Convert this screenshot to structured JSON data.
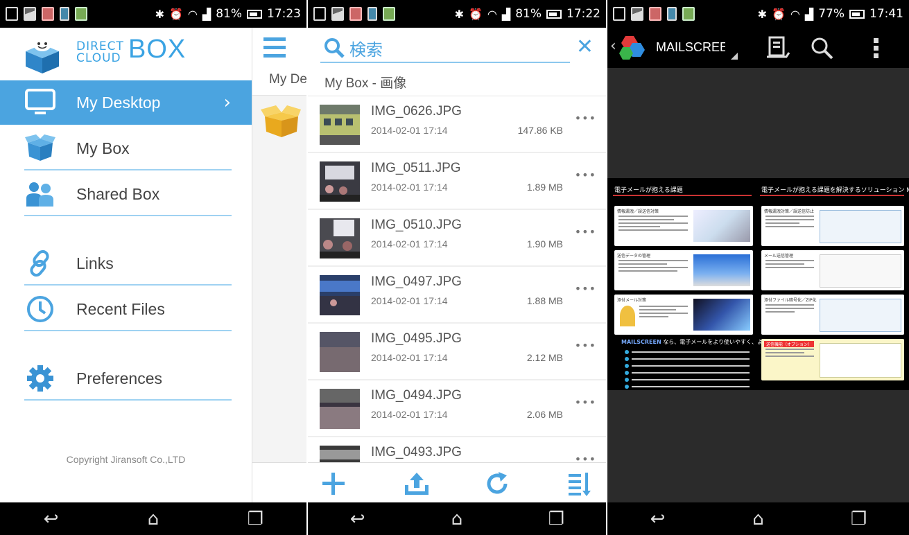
{
  "panel1": {
    "status": {
      "battery": "81%",
      "time": "17:23"
    },
    "logo": {
      "small_line1": "DIRECT",
      "small_line2": "CLOUD",
      "big": "BOX"
    },
    "menu": [
      {
        "label": "My Desktop",
        "icon": "monitor-icon",
        "active": true
      },
      {
        "label": "My Box",
        "icon": "box-icon"
      },
      {
        "label": "Shared Box",
        "icon": "people-icon"
      },
      {
        "label": "Links",
        "icon": "link-icon"
      },
      {
        "label": "Recent Files",
        "icon": "clock-icon"
      },
      {
        "label": "Preferences",
        "icon": "gear-icon"
      }
    ],
    "copyright": "Copyright Jiransoft Co.,LTD",
    "peek_crumb": "My De"
  },
  "panel2": {
    "status": {
      "battery": "81%",
      "time": "17:22"
    },
    "search_placeholder": "検索",
    "breadcrumb": "My Box  - 画像",
    "files": [
      {
        "name": "IMG_0626.JPG",
        "date": "2014-02-01 17:14",
        "size": "147.86 KB"
      },
      {
        "name": "IMG_0511.JPG",
        "date": "2014-02-01 17:14",
        "size": "1.89 MB"
      },
      {
        "name": "IMG_0510.JPG",
        "date": "2014-02-01 17:14",
        "size": "1.90 MB"
      },
      {
        "name": "IMG_0497.JPG",
        "date": "2014-02-01 17:14",
        "size": "1.88 MB"
      },
      {
        "name": "IMG_0495.JPG",
        "date": "2014-02-01 17:14",
        "size": "2.12 MB"
      },
      {
        "name": "IMG_0494.JPG",
        "date": "2014-02-01 17:14",
        "size": "2.06 MB"
      },
      {
        "name": "IMG_0493.JPG",
        "date": "",
        "size": ""
      }
    ],
    "more_glyph": "•••",
    "toolbar": [
      "add-icon",
      "upload-icon",
      "refresh-icon",
      "sort-icon"
    ]
  },
  "panel3": {
    "status": {
      "battery": "77%",
      "time": "17:41"
    },
    "app_title": "MAILSCREE",
    "doc": {
      "left_title": "電子メールが抱える課題",
      "right_title": "電子メールが抱える課題を解決するソリューション  MAILSCREEN",
      "cards_left": [
        "情報漏洩／誤送信対策",
        "送信データの管理",
        "添付メール対策"
      ],
      "cards_right": [
        "情報漏洩対策／誤送信防止",
        "メール送信管理",
        "添付ファイル暗号化／ZIP化",
        "送信機能（オプション）"
      ],
      "mailscreen_line_brand": "MAILSCREEN",
      "mailscreen_line_rest": " なら、電子メールをより使いやすく、より安全に。"
    }
  },
  "colors": {
    "accent": "#4ba4e0",
    "line": "#9fd2f2",
    "box_yellow": "#f0b429"
  }
}
